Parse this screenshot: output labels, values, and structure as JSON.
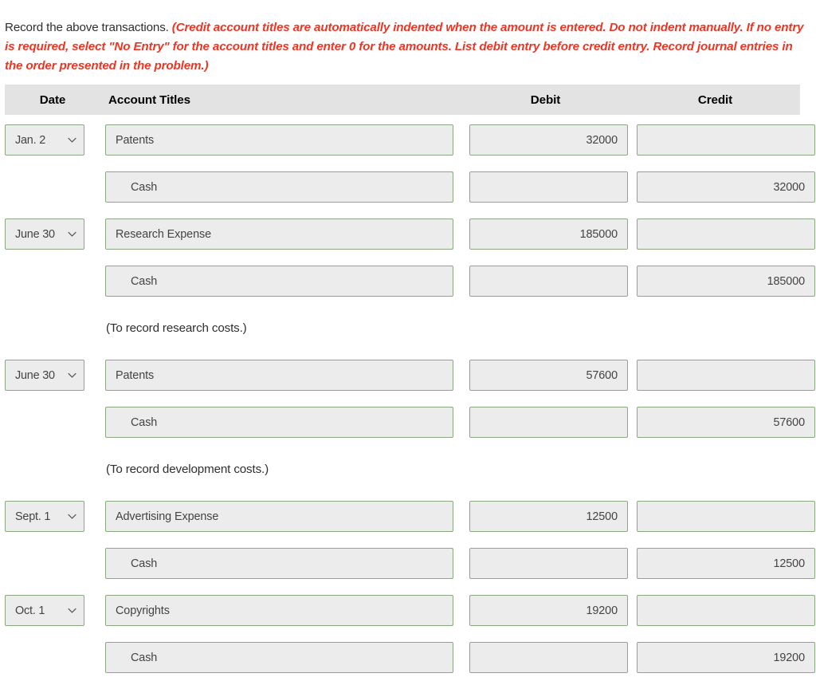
{
  "instructions": {
    "lead": "Record the above transactions.",
    "note": "(Credit account titles are automatically indented when the amount is entered. Do not indent manually. If no entry is required, select \"No Entry\" for the account titles and enter 0 for the amounts. List debit entry before credit entry. Record journal entries in the order presented in the problem.)",
    "note_color": "#ee3524"
  },
  "table": {
    "headers": {
      "date": "Date",
      "account_titles": "Account Titles",
      "debit": "Debit",
      "credit": "Credit"
    },
    "header_background": "#e3e3e3",
    "field_border_color": "#8ba882",
    "field_background": "#ececec",
    "rows": [
      {
        "kind": "entry",
        "date": "Jan. 2",
        "account": "Patents",
        "indent": false,
        "debit": "32000",
        "credit": ""
      },
      {
        "kind": "entry",
        "date": "",
        "account": "Cash",
        "indent": true,
        "debit": "",
        "credit": "32000"
      },
      {
        "kind": "entry",
        "date": "June 30",
        "account": "Research Expense",
        "indent": false,
        "debit": "185000",
        "credit": ""
      },
      {
        "kind": "entry",
        "date": "",
        "account": "Cash",
        "indent": true,
        "debit": "",
        "credit": "185000"
      },
      {
        "kind": "memo",
        "text": "(To record research costs.)"
      },
      {
        "kind": "entry",
        "date": "June 30",
        "account": "Patents",
        "indent": false,
        "debit": "57600",
        "credit": ""
      },
      {
        "kind": "entry",
        "date": "",
        "account": "Cash",
        "indent": true,
        "debit": "",
        "credit": "57600"
      },
      {
        "kind": "memo",
        "text": "(To record development costs.)"
      },
      {
        "kind": "entry",
        "date": "Sept. 1",
        "account": "Advertising Expense",
        "indent": false,
        "debit": "12500",
        "credit": ""
      },
      {
        "kind": "entry",
        "date": "",
        "account": "Cash",
        "indent": true,
        "debit": "",
        "credit": "12500"
      },
      {
        "kind": "entry",
        "date": "Oct. 1",
        "account": "Copyrights",
        "indent": false,
        "debit": "19200",
        "credit": ""
      },
      {
        "kind": "entry",
        "date": "",
        "account": "Cash",
        "indent": true,
        "debit": "",
        "credit": "19200"
      }
    ]
  },
  "icons": {
    "date_dropdown": "chevron-down-icon"
  }
}
